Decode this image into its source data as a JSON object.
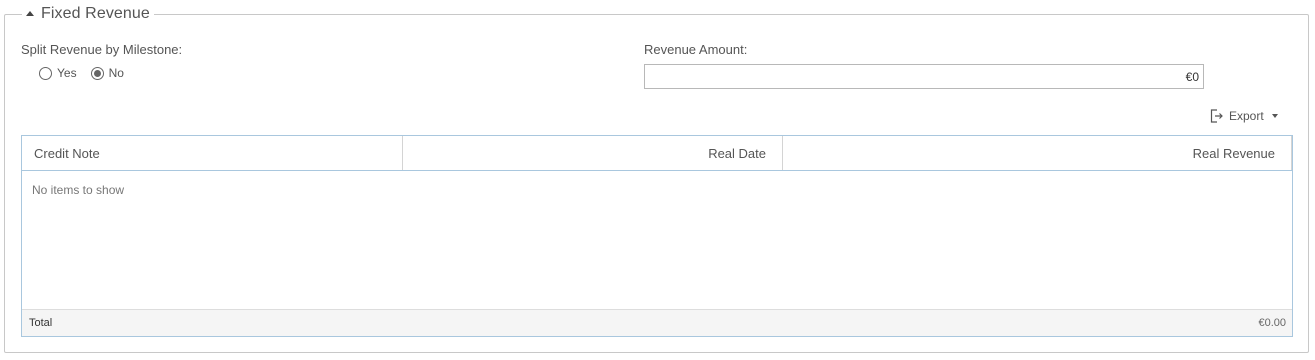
{
  "section": {
    "title": "Fixed Revenue"
  },
  "split_milestone": {
    "label": "Split Revenue by Milestone:",
    "options": [
      {
        "label": "Yes",
        "selected": false
      },
      {
        "label": "No",
        "selected": true
      }
    ]
  },
  "revenue_amount": {
    "label": "Revenue Amount:",
    "value": "€0"
  },
  "toolbar": {
    "export_label": "Export",
    "export_icon": "export-icon"
  },
  "grid": {
    "columns": [
      "Credit Note",
      "Real Date",
      "Real Revenue"
    ],
    "empty_message": "No items to show",
    "footer": {
      "total_label": "Total",
      "total_value": "€0.00"
    }
  },
  "colors": {
    "grid_border": "#a9c7de",
    "footer_bg": "#f5f5f5"
  }
}
